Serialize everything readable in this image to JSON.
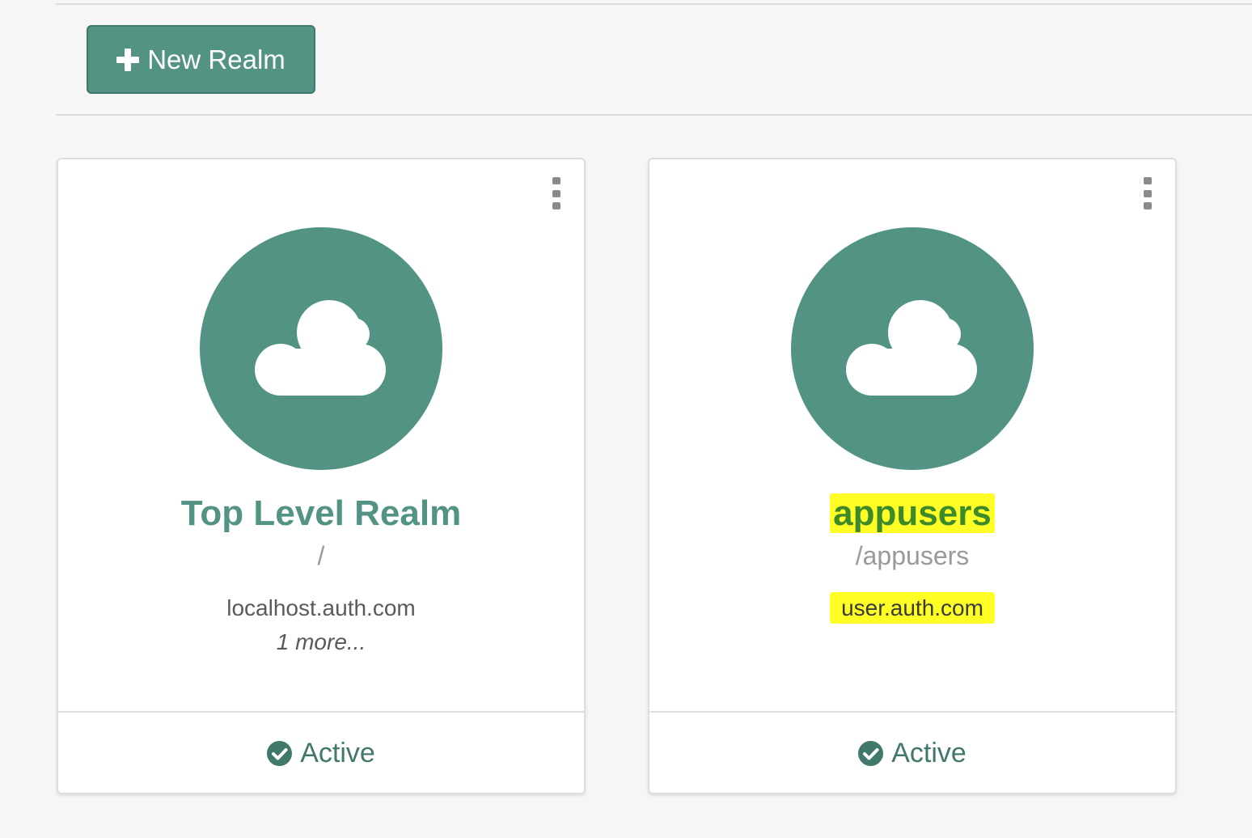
{
  "colors": {
    "accent": "#529384",
    "accent_dark": "#40786b",
    "highlight": "#ffff26",
    "page_bg": "#f6f6f6"
  },
  "toolbar": {
    "new_realm_label": "New Realm",
    "new_realm_icon": "plus-icon"
  },
  "realms": [
    {
      "name": "Top Level Realm",
      "path": "/",
      "domain": "localhost.auth.com",
      "more": "1 more...",
      "status": "Active",
      "status_icon": "check-circle-icon",
      "avatar_icon": "cloud-icon",
      "menu_icon": "kebab-menu-icon",
      "highlighted": false
    },
    {
      "name": "appusers",
      "path": "/appusers",
      "domain": "user.auth.com",
      "status": "Active",
      "status_icon": "check-circle-icon",
      "avatar_icon": "cloud-icon",
      "menu_icon": "kebab-menu-icon",
      "highlighted": true
    }
  ]
}
